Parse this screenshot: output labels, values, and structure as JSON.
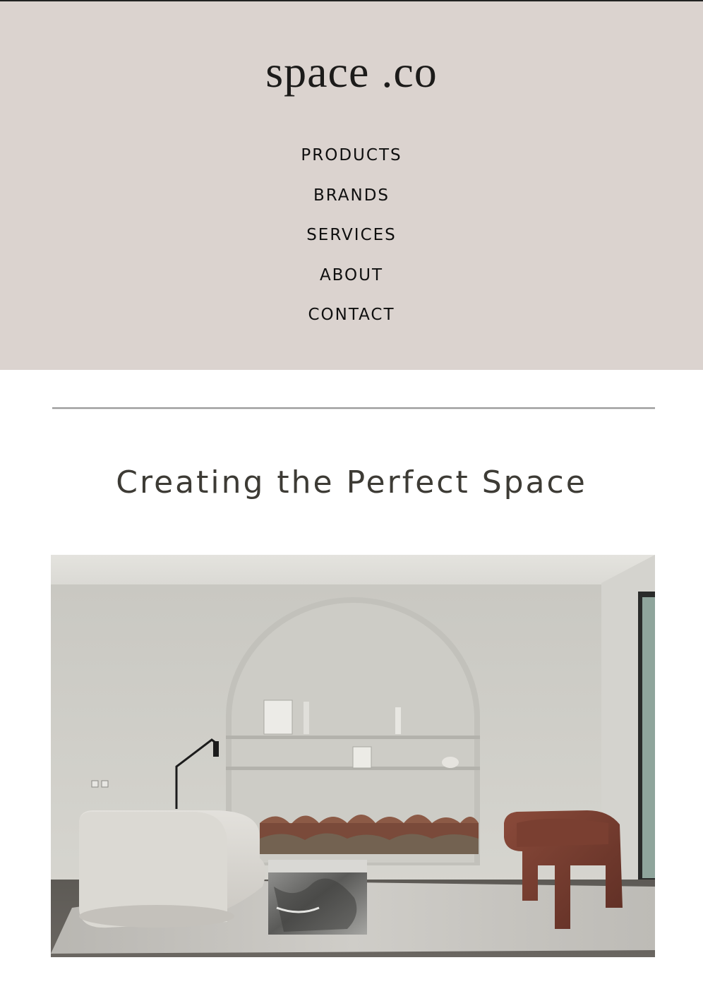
{
  "brand": {
    "logo_text": "space .co"
  },
  "nav": {
    "items": [
      {
        "label": "PRODUCTS"
      },
      {
        "label": "BRANDS"
      },
      {
        "label": "SERVICES"
      },
      {
        "label": "ABOUT"
      },
      {
        "label": "CONTACT"
      }
    ]
  },
  "main": {
    "headline": "Creating the Perfect Space"
  },
  "colors": {
    "header_bg": "#dbd3cf",
    "page_bg": "#ffffff",
    "headline_text": "#3d3b35",
    "nav_text": "#0f0f0f"
  }
}
